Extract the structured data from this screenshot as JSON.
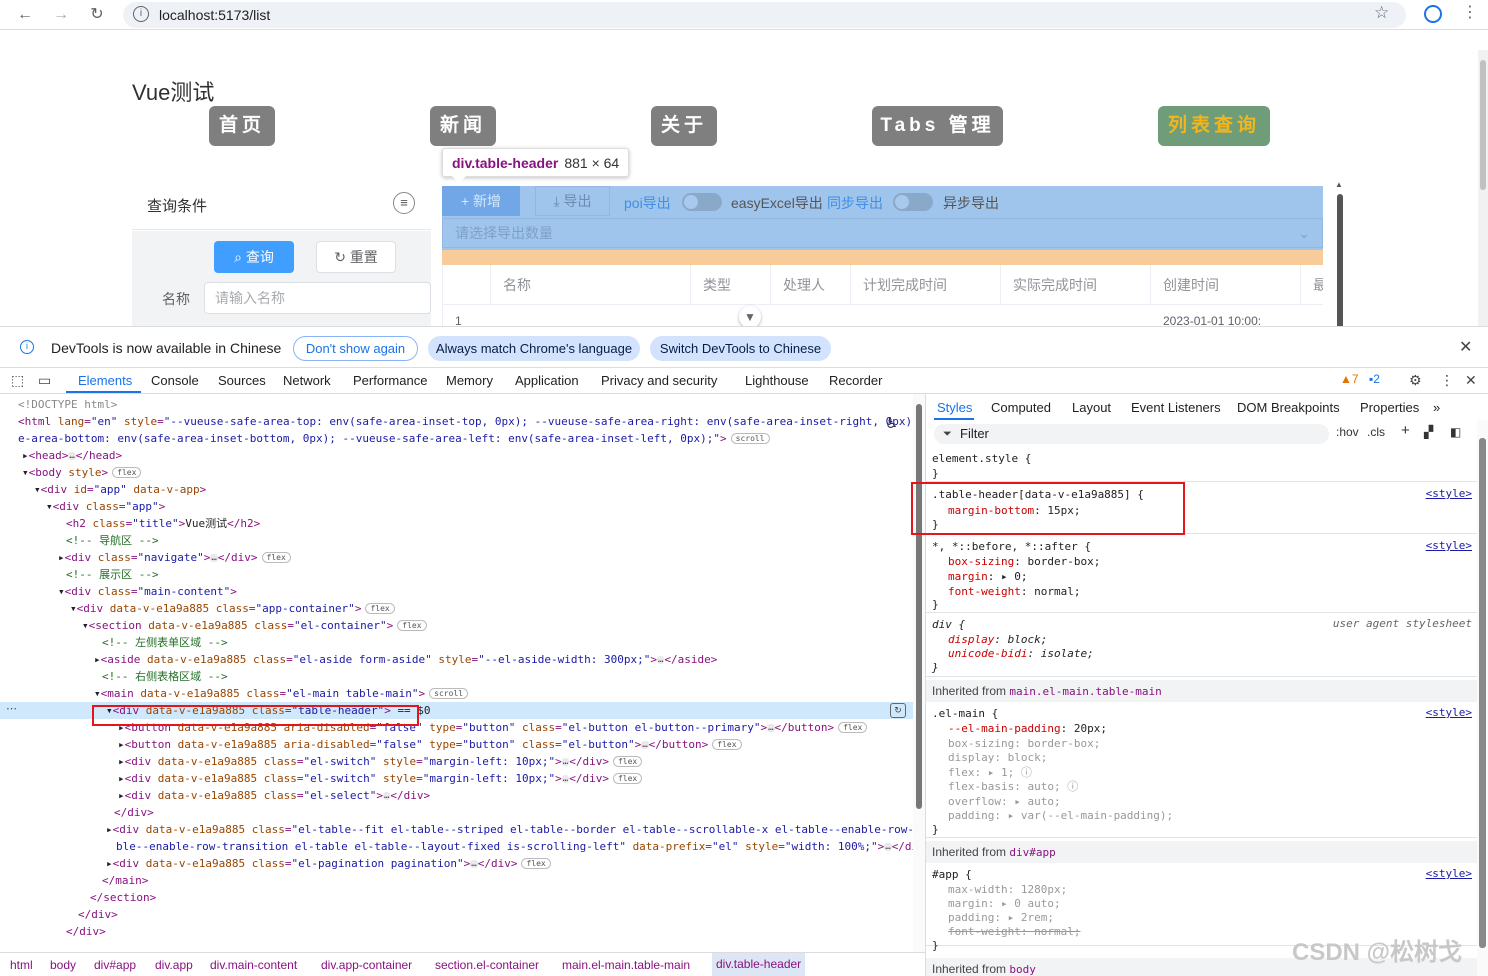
{
  "browser": {
    "url": "localhost:5173/list",
    "nav": {
      "back": "←",
      "forward": "→",
      "reload": "↻"
    }
  },
  "app": {
    "title": "Vue测试",
    "nav_buttons": [
      "首页",
      "新闻",
      "关于",
      "Tabs 管理",
      "列表查询"
    ],
    "active_nav": "列表查询",
    "tooltip": {
      "selector": "div.table-header",
      "size": "881 × 64"
    },
    "aside": {
      "header": "查询条件",
      "query_button": "查询",
      "reset_button": "重置",
      "name_label": "名称",
      "name_placeholder": "请输入名称"
    },
    "table_header": {
      "add_button": "新增",
      "export_button": "导出",
      "switch1_left": "poi导出",
      "switch1_right": "easyExcel导出",
      "switch2_left": "同步导出",
      "switch2_right": "异步导出",
      "select_placeholder": "请选择导出数量"
    },
    "table": {
      "columns": [
        "名称",
        "类型",
        "处理人",
        "计划完成时间",
        "实际完成时间",
        "创建时间",
        "最"
      ],
      "partial_row": {
        "index": "1",
        "created": "2023-01-01 10:00:"
      }
    }
  },
  "infobar": {
    "message": "DevTools is now available in Chinese",
    "buttons": [
      "Don't show again",
      "Always match Chrome's language",
      "Switch DevTools to Chinese"
    ]
  },
  "devtools": {
    "tabs": [
      "Elements",
      "Console",
      "Sources",
      "Network",
      "Performance",
      "Memory",
      "Application",
      "Privacy and security",
      "Lighthouse",
      "Recorder"
    ],
    "active_tab": "Elements",
    "warnings": "7",
    "messages": "2",
    "styles_tabs": [
      "Styles",
      "Computed",
      "Layout",
      "Event Listeners",
      "DOM Breakpoints",
      "Properties"
    ],
    "filter_placeholder": "Filter",
    "hov": ":hov",
    "cls": ".cls",
    "breadcrumb": [
      "html",
      "body",
      "div#app",
      "div.app",
      "div.main-content",
      "div.app-container",
      "section.el-container",
      "main.el-main.table-main",
      "div.table-header"
    ]
  },
  "watermark": "CSDN @松树戈",
  "colors": {
    "accent": "#1a73e8",
    "highlight_box": "#e3161b",
    "tag": "#881280",
    "attr": "#994500",
    "value": "#1a1aa6",
    "comment": "#236e25"
  }
}
